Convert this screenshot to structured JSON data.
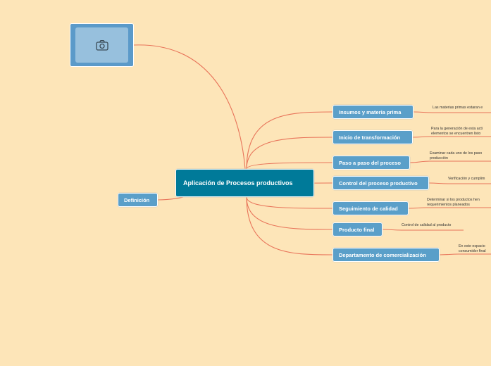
{
  "central": {
    "label": "Aplicación de Procesos productivos"
  },
  "definition": {
    "label": "Definición"
  },
  "image_node": {
    "icon": "camera-icon"
  },
  "branches": [
    {
      "label": "Insumos y materia prima",
      "note": "Las materias primas estaran e"
    },
    {
      "label": "Inicio de transformación",
      "note": "Para la generación de esta acti\nelementos se encuentren listo"
    },
    {
      "label": "Paso a paso del proceso",
      "note": "Examinar cada uno de los paso\nproducción"
    },
    {
      "label": "Control del proceso productivo",
      "note": "Verificación y cumplim"
    },
    {
      "label": "Seguimiento de calidad",
      "note": "Determinar si los productos hen\nrequerimientos planeados"
    },
    {
      "label": "Producto final",
      "note": "Control de calidad al producto"
    },
    {
      "label": "Departamento de comercialización",
      "note": "En este espacio\nconsumidor final"
    }
  ],
  "colors": {
    "background": "#fde5b8",
    "link": "#e8745a",
    "node": "#5a9fc9",
    "central": "#007a99"
  }
}
